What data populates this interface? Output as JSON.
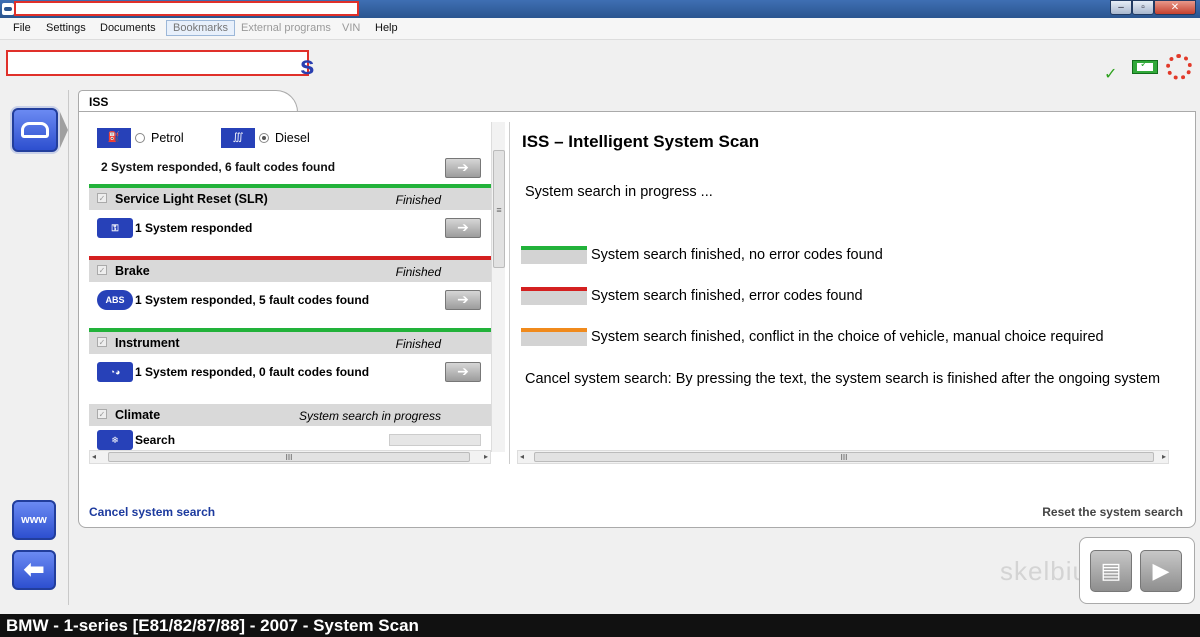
{
  "menu": {
    "file": "File",
    "settings": "Settings",
    "documents": "Documents",
    "bookmarks": "Bookmarks",
    "external_programs": "External programs",
    "vin": "VIN",
    "help": "Help"
  },
  "header": {
    "tail_text": "s"
  },
  "nav": {
    "www_label": "www",
    "back_glyph": "⬅"
  },
  "tab": {
    "label": "ISS"
  },
  "fuel": {
    "petrol_label": "Petrol",
    "diesel_label": "Diesel",
    "selected": "Diesel",
    "summary": "2 System responded, 6 fault codes found"
  },
  "systems": [
    {
      "name": "Service Light Reset (SLR)",
      "status": "Finished",
      "info": "1 System responded",
      "line_color": "#22b23a",
      "icon": "wrench-icon",
      "icon_text": "⚿"
    },
    {
      "name": "Brake",
      "status": "Finished",
      "info": "1 System responded, 5 fault codes found",
      "line_color": "#d42020",
      "icon": "abs-icon",
      "icon_text": "ABS"
    },
    {
      "name": "Instrument",
      "status": "Finished",
      "info": "1 System responded, 0 fault codes found",
      "line_color": "#22b23a",
      "icon": "instrument-icon",
      "icon_text": "◔◕"
    },
    {
      "name": "Climate",
      "status": "System search in progress",
      "info": "Search",
      "line_color": "",
      "icon": "climate-icon",
      "icon_text": "❄"
    }
  ],
  "info": {
    "title": "ISS – Intelligent System Scan",
    "progress_text": "System search in progress ...",
    "legend": [
      {
        "color": "#22b23a",
        "text": "System search finished, no error codes found"
      },
      {
        "color": "#d42020",
        "text": "System search finished, error codes found"
      },
      {
        "color": "#f08a1c",
        "text": "System search finished, conflict in the choice of vehicle, manual choice required"
      }
    ],
    "cancel_note": "Cancel system search: By pressing the text, the system search is finished after the ongoing system"
  },
  "links": {
    "cancel": "Cancel system search",
    "reset": "Reset the system search"
  },
  "watermark": "skelbiu.lt",
  "status_bar": "BMW - 1-series [E81/82/87/88] - 2007 - System Scan"
}
